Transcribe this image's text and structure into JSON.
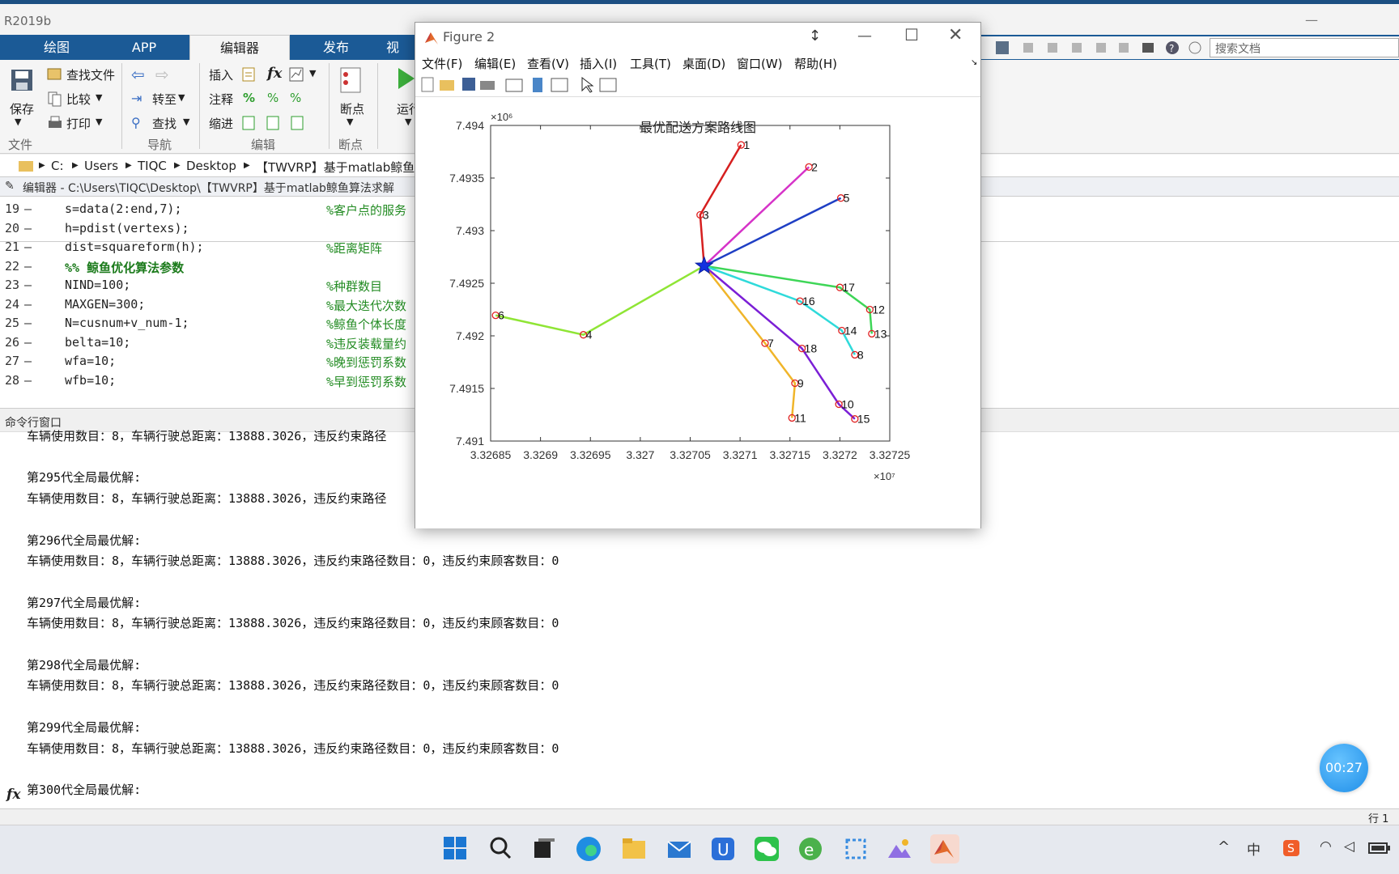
{
  "app": {
    "title": "R2019b"
  },
  "ribbon": {
    "tabs": [
      "绘图",
      "APP",
      "编辑器",
      "发布",
      "视"
    ],
    "active_tab": "编辑器",
    "file": {
      "save": "保存",
      "find_files": "查找文件",
      "compare": "比较",
      "print": "打印",
      "group": "文件"
    },
    "nav": {
      "goto": "转至",
      "find": "查找",
      "group": "导航"
    },
    "edit": {
      "insert": "插入",
      "fx": "fx",
      "comment": "注释",
      "indent": "缩进",
      "group": "编辑"
    },
    "breakpoints": {
      "label": "断点",
      "group": "断点"
    },
    "run": {
      "label": "运行"
    }
  },
  "search": {
    "placeholder": "搜索文档"
  },
  "address": {
    "crumbs": [
      "C:",
      "Users",
      "TIQC",
      "Desktop",
      "【TWVRP】基于matlab鲸鱼"
    ]
  },
  "editor": {
    "title": "编辑器 - C:\\Users\\TIQC\\Desktop\\【TWVRP】基于matlab鲸鱼算法求解",
    "lines": [
      {
        "n": "19",
        "code": "s=data(2:end,7);",
        "comment": "%客户点的服务"
      },
      {
        "n": "20",
        "code": "h=pdist(vertexs);",
        "comment": ""
      },
      {
        "n": "21",
        "code": "dist=squareform(h);",
        "comment": "%距离矩阵"
      },
      {
        "n": "22",
        "code": "%% 鲸鱼优化算法参数",
        "comment": ""
      },
      {
        "n": "23",
        "code": "NIND=100;",
        "comment": "%种群数目"
      },
      {
        "n": "24",
        "code": "MAXGEN=300;",
        "comment": "%最大迭代次数"
      },
      {
        "n": "25",
        "code": "N=cusnum+v_num-1;",
        "comment": "%鲸鱼个体长度"
      },
      {
        "n": "26",
        "code": "belta=10;",
        "comment": "%违反装载量约"
      },
      {
        "n": "27",
        "code": "wfa=10;",
        "comment": "%晚到惩罚系数"
      },
      {
        "n": "28",
        "code": "wfb=10;",
        "comment": "%早到惩罚系数"
      }
    ]
  },
  "cmd": {
    "title": "命令行窗口",
    "lines": [
      "车辆使用数目：8，车辆行驶总距离：13888.3026，违反约束路径",
      "",
      "第295代全局最优解:",
      "车辆使用数目：8，车辆行驶总距离：13888.3026，违反约束路径",
      "",
      "第296代全局最优解:",
      "车辆使用数目：8，车辆行驶总距离：13888.3026，违反约束路径数目：0，违反约束顾客数目：0",
      "",
      "第297代全局最优解:",
      "车辆使用数目：8，车辆行驶总距离：13888.3026，违反约束路径数目：0，违反约束顾客数目：0",
      "",
      "第298代全局最优解:",
      "车辆使用数目：8，车辆行驶总距离：13888.3026，违反约束路径数目：0，违反约束顾客数目：0",
      "",
      "第299代全局最优解:",
      "车辆使用数目：8，车辆行驶总距离：13888.3026，违反约束路径数目：0，违反约束顾客数目：0",
      "",
      "第300代全局最优解:"
    ],
    "prompt": "fx"
  },
  "status": {
    "row_label": "行 1"
  },
  "timer": "00:27",
  "figure": {
    "title": "Figure 2",
    "menus": [
      "文件(F)",
      "编辑(E)",
      "查看(V)",
      "插入(I)",
      "工具(T)",
      "桌面(D)",
      "窗口(W)",
      "帮助(H)"
    ]
  },
  "chart_data": {
    "type": "line",
    "title": "最优配送方案路线图",
    "xlabel": "",
    "ylabel": "",
    "x_exponent": "×10⁷",
    "y_exponent": "×10⁶",
    "x_scale": 10000000,
    "y_scale": 1000000,
    "xlim": [
      3.32685,
      3.32725
    ],
    "ylim": [
      7.491,
      7.494
    ],
    "x_ticks": [
      "3.32685",
      "3.3269",
      "3.32695",
      "3.327",
      "3.32705",
      "3.3271",
      "3.32715",
      "3.3272",
      "3.32725"
    ],
    "y_ticks": [
      "7.491",
      "7.4915",
      "7.492",
      "7.4925",
      "7.493",
      "7.4935",
      "7.494"
    ],
    "depot": {
      "x": 3.327064,
      "y": 7.492665
    },
    "nodes": [
      {
        "id": "1",
        "x": 3.327101,
        "y": 7.493815
      },
      {
        "id": "2",
        "x": 3.327169,
        "y": 7.493605
      },
      {
        "id": "3",
        "x": 3.32706,
        "y": 7.49315
      },
      {
        "id": "4",
        "x": 3.326943,
        "y": 7.49201
      },
      {
        "id": "5",
        "x": 3.327201,
        "y": 7.49331
      },
      {
        "id": "6",
        "x": 3.326855,
        "y": 7.492195
      },
      {
        "id": "7",
        "x": 3.327125,
        "y": 7.49193
      },
      {
        "id": "8",
        "x": 3.327215,
        "y": 7.49182
      },
      {
        "id": "9",
        "x": 3.327155,
        "y": 7.49155
      },
      {
        "id": "10",
        "x": 3.327199,
        "y": 7.49135
      },
      {
        "id": "11",
        "x": 3.327152,
        "y": 7.49122
      },
      {
        "id": "12",
        "x": 3.32723,
        "y": 7.49225
      },
      {
        "id": "13",
        "x": 3.327232,
        "y": 7.49202
      },
      {
        "id": "14",
        "x": 3.327202,
        "y": 7.49205
      },
      {
        "id": "15",
        "x": 3.327215,
        "y": 7.49121
      },
      {
        "id": "16",
        "x": 3.32716,
        "y": 7.49233
      },
      {
        "id": "17",
        "x": 3.3272,
        "y": 7.49246
      },
      {
        "id": "18",
        "x": 3.327162,
        "y": 7.49188
      }
    ],
    "routes": [
      {
        "color": "#d61f1f",
        "path": [
          "depot",
          "3",
          "1"
        ]
      },
      {
        "color": "#d633c8",
        "path": [
          "depot",
          "2"
        ]
      },
      {
        "color": "#1f3fc4",
        "path": [
          "depot",
          "5"
        ]
      },
      {
        "color": "#3ed657",
        "path": [
          "depot",
          "17",
          "12",
          "13"
        ]
      },
      {
        "color": "#2fdada",
        "path": [
          "depot",
          "16",
          "14",
          "8"
        ]
      },
      {
        "color": "#7b1fd6",
        "path": [
          "depot",
          "18",
          "10",
          "15"
        ]
      },
      {
        "color": "#f0b52a",
        "path": [
          "depot",
          "7",
          "9",
          "11"
        ]
      },
      {
        "color": "#8fe535",
        "path": [
          "depot",
          "4",
          "6"
        ]
      }
    ]
  }
}
